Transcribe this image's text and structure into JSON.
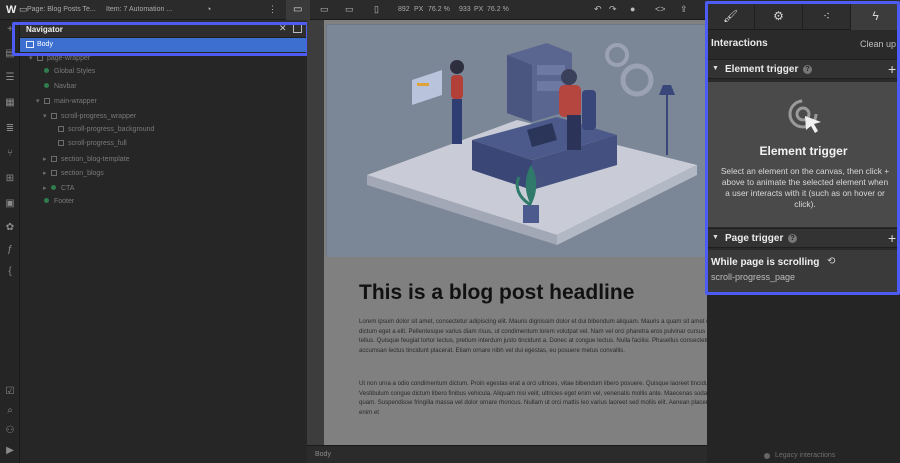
{
  "topbar": {
    "page_label": "Page: Blog Posts Te...",
    "item_label": "Item: 7 Automation ...",
    "width_value": "892",
    "width_unit": "PX",
    "zoom1": "76.2 %",
    "height_value": "933",
    "height_unit": "PX",
    "zoom2": "76.2 %"
  },
  "navigator": {
    "title": "Navigator",
    "body_label": "Body",
    "tree": [
      {
        "label": "page-wrapper",
        "indent": 0,
        "kind": "box",
        "caret": "▾"
      },
      {
        "label": "Global Styles",
        "indent": 1,
        "kind": "dot",
        "caret": ""
      },
      {
        "label": "Navbar",
        "indent": 1,
        "kind": "dot",
        "caret": ""
      },
      {
        "label": "main-wrapper",
        "indent": 1,
        "kind": "box",
        "caret": "▾"
      },
      {
        "label": "scroll-progress_wrapper",
        "indent": 2,
        "kind": "box",
        "caret": "▾"
      },
      {
        "label": "scroll-progress_background",
        "indent": 3,
        "kind": "box",
        "caret": ""
      },
      {
        "label": "scroll-progress_full",
        "indent": 3,
        "kind": "box",
        "caret": ""
      },
      {
        "label": "section_blog-template",
        "indent": 2,
        "kind": "box",
        "caret": "▸"
      },
      {
        "label": "section_blogs",
        "indent": 2,
        "kind": "box",
        "caret": "▸"
      },
      {
        "label": "CTA",
        "indent": 2,
        "kind": "dot",
        "caret": "▸"
      },
      {
        "label": "Footer",
        "indent": 1,
        "kind": "dot",
        "caret": ""
      }
    ]
  },
  "canvas": {
    "headline": "This is a blog post headline",
    "para1": "Lorem ipsum dolor sit amet, consectetur adipiscing elit. Mauris dignissim dolor et dui bibendum aliquam. Mauris a quam sit amet dui auctor dictum eget a elit. Pellentesque varius diam risus, ut condimentum lorem volutpat vel. Nam vel orci pharetra eros pulvinar cursus nec quis tellus. Quisque feugiat tortor lectus, pretium interdum justo tincidunt a. Donec at congue lectus. Nulla facilisi. Phasellus consectetur sapien accumsan lectus tincidunt placerat. Etiam ornare nibh vel dui egestas, eu posuere metus convallis.",
    "para2": "Ut non urna a odio condimentum dictum. Proin egestas erat a orci ultrices, vitae bibendum libero posuere. Quisque laoreet tincidunt justo. Vestibulum congue dictum libero finibus vehicula. Aliquam nisi velit, ultricies eget enim vel, venenatis mollis ante. Maecenas sodales tristique quam. Suspendisse fringilla massa vel dolor ornare rhoncus. Nullam ut orci mattis leo varius laoreet sed mollis elit. Aenean placerat nec enim et",
    "footer_crumb": "Body"
  },
  "right_panel": {
    "tabs": [
      "brush-icon",
      "gear-icon",
      "drops-icon",
      "lightning-icon"
    ],
    "interactions_title": "Interactions",
    "cleanup_label": "Clean up",
    "element_trigger_label": "Element trigger",
    "element_trigger_empty_title": "Element trigger",
    "element_trigger_empty_desc": "Select an element on the canvas, then click + above to animate the selected element when a user interacts with it (such as on hover or click).",
    "page_trigger_label": "Page trigger",
    "scroll_trigger_title": "While page is scrolling",
    "scroll_trigger_target": "scroll-progress_page",
    "legacy_label": "Legacy interactions"
  },
  "colors": {
    "highlight": "#4c5cf5",
    "selection": "#3d6fd1"
  }
}
